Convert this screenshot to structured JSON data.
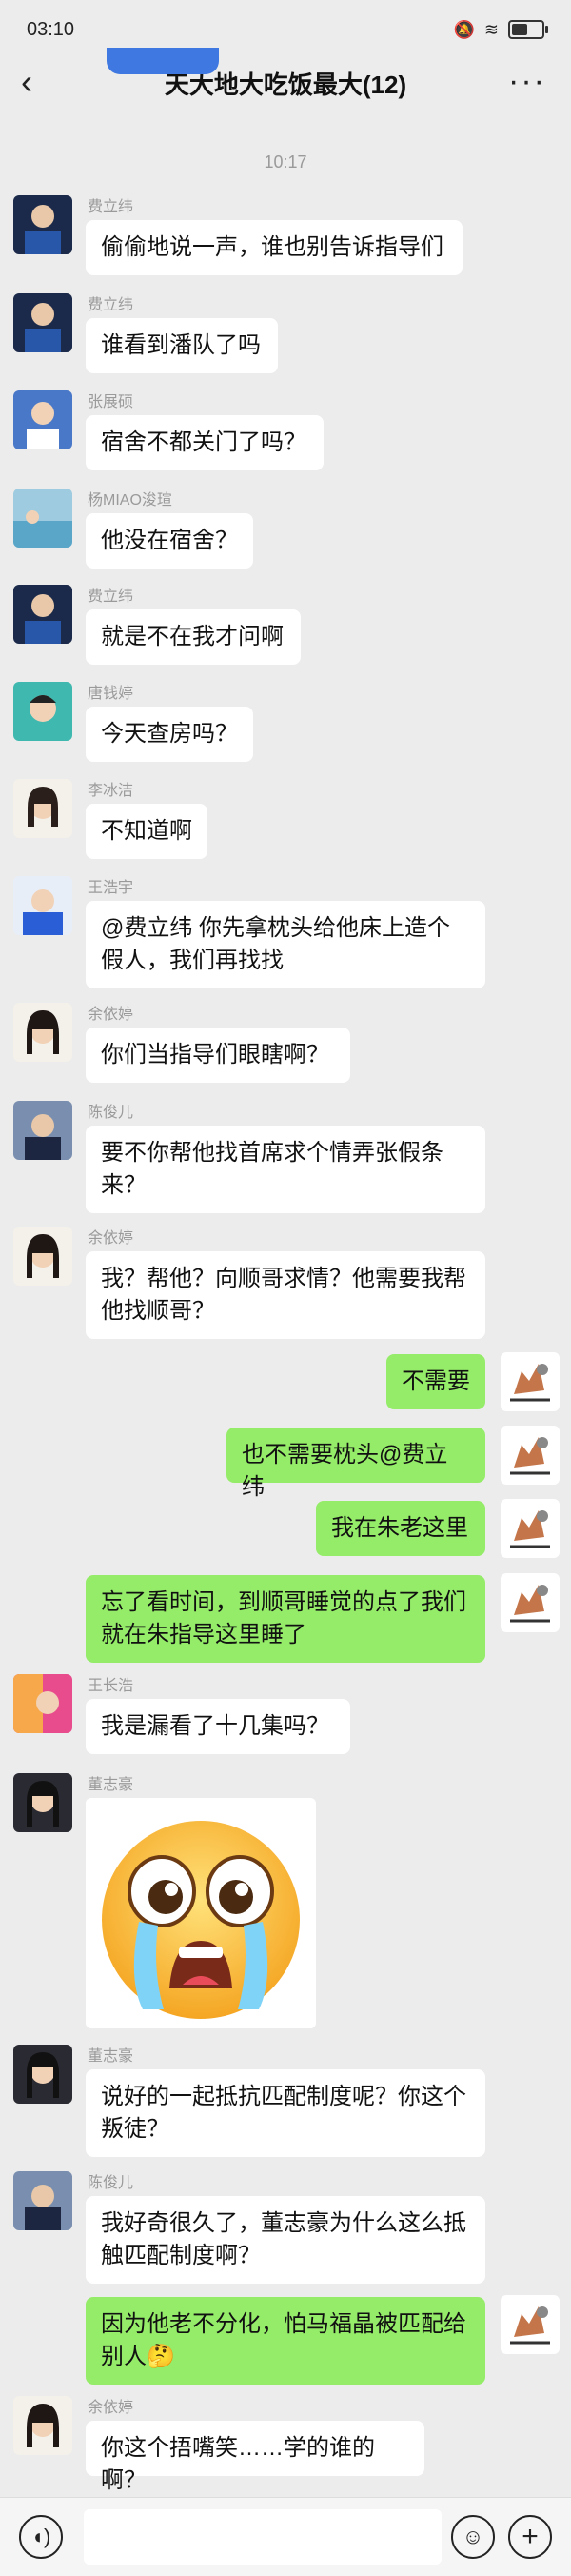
{
  "status": {
    "time": "03:10"
  },
  "header": {
    "title": "天大地大吃饭最大(12)"
  },
  "timestamp": "10:17",
  "messages": [
    {
      "sender": "费立纬",
      "text": "偷偷地说一声，谁也别告诉指导们"
    },
    {
      "sender": "费立纬",
      "text": "谁看到潘队了吗"
    },
    {
      "sender": "张展硕",
      "text": "宿舍不都关门了吗？"
    },
    {
      "sender": "杨MIAO浚瑄",
      "text": "他没在宿舍？"
    },
    {
      "sender": "费立纬",
      "text": "就是不在我才问啊"
    },
    {
      "sender": "唐钱婷",
      "text": "今天查房吗？"
    },
    {
      "sender": "李冰洁",
      "text": "不知道啊"
    },
    {
      "sender": "王浩宇",
      "text": "@费立纬 你先拿枕头给他床上造个假人，我们再找找"
    },
    {
      "sender": "余依婷",
      "text": "你们当指导们眼瞎啊？"
    },
    {
      "sender": "陈俊儿",
      "text": "要不你帮他找首席求个情弄张假条来？"
    },
    {
      "sender": "余依婷",
      "text": "我？帮他？向顺哥求情？他需要我帮他找顺哥？"
    },
    {
      "sender": "",
      "text": "不需要"
    },
    {
      "sender": "",
      "text": "也不需要枕头@费立纬"
    },
    {
      "sender": "",
      "text": "我在朱老这里"
    },
    {
      "sender": "",
      "text": "忘了看时间，到顺哥睡觉的点了我们就在朱指导这里睡了"
    },
    {
      "sender": "王长浩",
      "text": "我是漏看了十几集吗？"
    },
    {
      "sender": "董志豪",
      "text": ""
    },
    {
      "sender": "董志豪",
      "text": "说好的一起抵抗匹配制度呢？你这个叛徒？"
    },
    {
      "sender": "陈俊儿",
      "text": "我好奇很久了，董志豪为什么这么抵触匹配制度啊？"
    },
    {
      "sender": "",
      "text": "因为他老不分化，怕马福晶被匹配给别人🤔"
    },
    {
      "sender": "余依婷",
      "text": "你这个捂嘴笑……学的谁的啊？"
    }
  ],
  "colors": {
    "self_bubble": "#95ec69",
    "other_bubble": "#ffffff",
    "background": "#ececec"
  },
  "icons": [
    "back-icon",
    "more-icon",
    "voice-icon",
    "emoji-icon",
    "plus-icon"
  ]
}
